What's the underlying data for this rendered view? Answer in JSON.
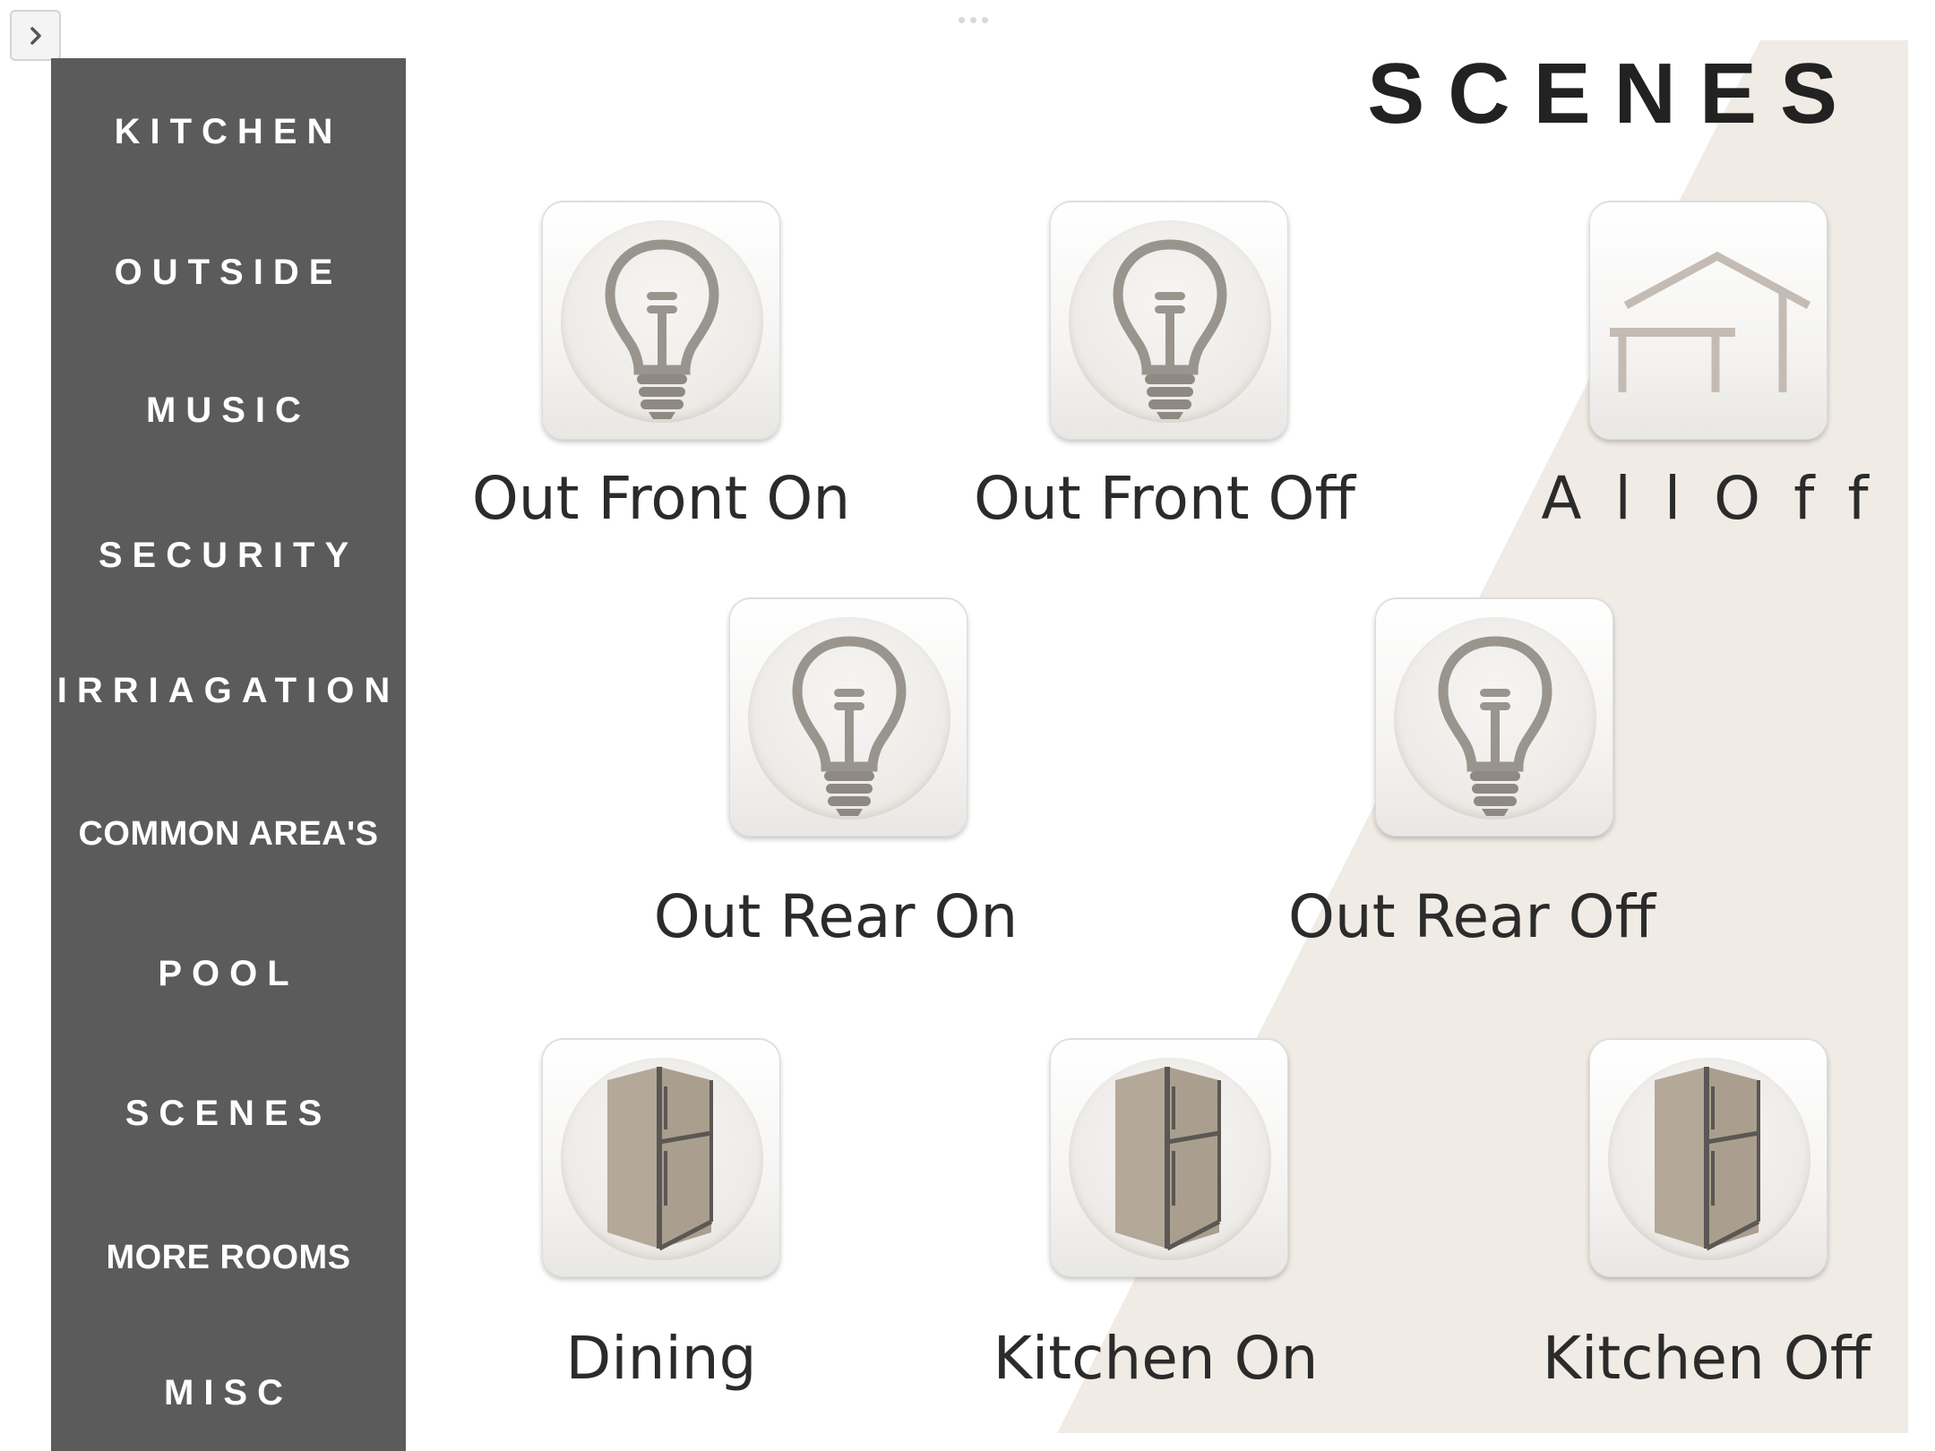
{
  "page": {
    "title": "SCENES"
  },
  "colors": {
    "sidebar": "#5b5b5b",
    "accent_beige": "#f0ebe5",
    "text": "#2b2b2b",
    "icon_gray": "#9a948e",
    "fridge": "#b4a898"
  },
  "sidebar": {
    "toggle_icon": "chevron-right-icon",
    "items": [
      {
        "label": "KITCHEN"
      },
      {
        "label": "OUTSIDE"
      },
      {
        "label": "MUSIC"
      },
      {
        "label": "SECURITY"
      },
      {
        "label": "IRRIAGATION"
      },
      {
        "label": "COMMON AREA'S"
      },
      {
        "label": "POOL"
      },
      {
        "label": "SCENES"
      },
      {
        "label": "MORE ROOMS"
      },
      {
        "label": "MISC"
      }
    ]
  },
  "scenes": [
    {
      "label": "Out Front On",
      "icon": "lightbulb-icon"
    },
    {
      "label": "Out Front Off",
      "icon": "lightbulb-icon"
    },
    {
      "label": "A l l  O f f",
      "icon": "house-icon"
    },
    {
      "label": "Out Rear On",
      "icon": "lightbulb-icon"
    },
    {
      "label": "Out Rear Off",
      "icon": "lightbulb-icon"
    },
    {
      "label": "Dining",
      "icon": "refrigerator-icon"
    },
    {
      "label": "Kitchen On",
      "icon": "refrigerator-icon"
    },
    {
      "label": "Kitchen Off",
      "icon": "refrigerator-icon"
    }
  ]
}
